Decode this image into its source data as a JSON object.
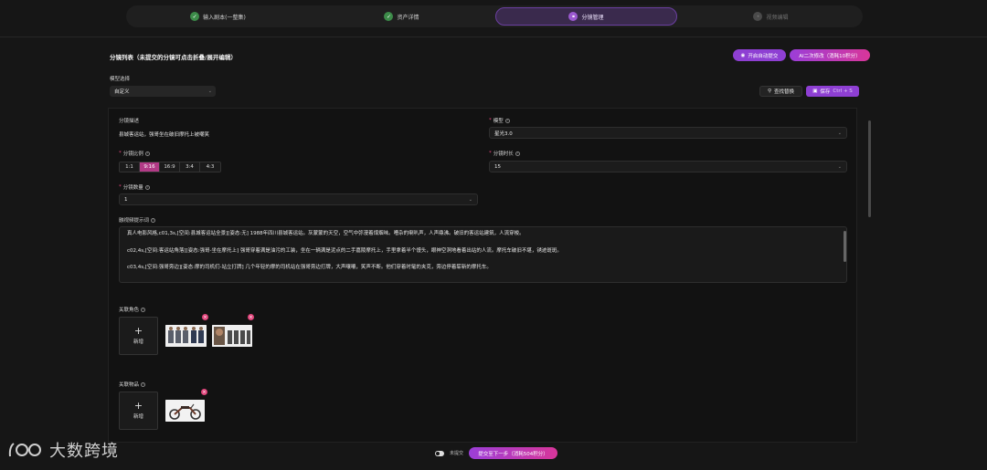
{
  "stepper": {
    "steps": [
      {
        "label": "输入剧本(一整集)",
        "state": "done",
        "icon": "check-icon"
      },
      {
        "label": "资产详情",
        "state": "done",
        "icon": "check-icon"
      },
      {
        "label": "分镜管理",
        "state": "current",
        "icon": "link-icon"
      },
      {
        "label": "视频编辑",
        "state": "future",
        "icon": "dot-icon"
      }
    ]
  },
  "header": {
    "title": "分镜列表（未提交的分镜可点击折叠/展开编辑）",
    "auto_submit_label": "开启自动提交",
    "ai_edit_label": "AI二次修改（消耗10积分）"
  },
  "model_select": {
    "label": "模型选择",
    "value": "自定义"
  },
  "toolbar": {
    "search_replace_label": "查找替换",
    "save_label": "保存",
    "save_shortcut": "Ctrl + S"
  },
  "form": {
    "description_label": "分镜描述",
    "description_value": "县城客运站，强哥坐在破旧摩托上被嘲笑",
    "model_label": "模型",
    "model_value": "星光3.0",
    "ratio_label": "分镜比例",
    "ratios": [
      "1:1",
      "9:16",
      "16:9",
      "3:4",
      "4:3"
    ],
    "selected_ratio": "9:16",
    "duration_label": "分镜时长",
    "duration_value": "15",
    "count_label": "分镜数量",
    "count_value": "1",
    "prompt_label": "融视频提示词",
    "prompt_lines": [
      "真人电影风格,c01,3s,[空间:县城客运站全景][姿态:无] 1988年四川县城客运站。灰蒙蒙的天空，空气中弥漫着煤烟味。嘈杂的喇叭声，人声鼎沸。破旧的客运站建筑，人流穿梭。",
      "c02,4s,[空间:客运站角落][姿态:强哥-坐在摩托上] 强哥穿着满是油污的工装，坐在一辆满是泥点的二手嘉陵摩托上，手里拿着半个馒头，眼神空洞地看着出站的人流。摩托车破旧不堪，锈迹斑斑。",
      "c03,4s,[空间:强哥旁边][姿态:摩的司机们-站立打牌] 几个年轻的摩的司机站在强哥旁边打牌，大声嚷嚷，笑声不断。他们穿着时髦的夹克，旁边停着崭新的摩托车。"
    ],
    "characters_label": "关联角色",
    "add_label": "新增",
    "props_label": "关联物品"
  },
  "footer": {
    "toggle_label": "未提交",
    "next_label": "提交至下一步（消耗504积分）"
  },
  "watermark": {
    "text": "大数跨境"
  },
  "colors": {
    "accent": "#8e3fd3",
    "pink": "#d8369a",
    "done": "#3c8b49"
  }
}
